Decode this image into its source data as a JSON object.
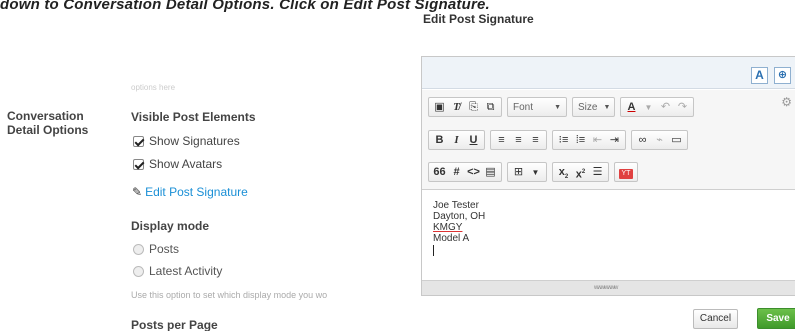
{
  "caption": "down to Conversation Detail Options. Click on Edit Post Signature.",
  "settings": {
    "hint_text": "options here",
    "section_label": "Conversation Detail Options",
    "visible_post_elements": {
      "title": "Visible Post Elements",
      "items": [
        {
          "label": "Show Signatures",
          "checked": true
        },
        {
          "label": "Show Avatars",
          "checked": true
        }
      ]
    },
    "edit_signature_link": "Edit Post Signature",
    "display_mode": {
      "title": "Display mode",
      "options": [
        {
          "label": "Posts",
          "selected": false
        },
        {
          "label": "Latest Activity",
          "selected": false
        }
      ],
      "help": "Use this option to set which display mode you wo"
    },
    "posts_per_page_title": "Posts per Page"
  },
  "dialog": {
    "title": "Edit Post Signature",
    "mode_button": "A",
    "toolbar": {
      "font_label": "Font",
      "size_label": "Size",
      "color_label": "A",
      "bold": "B",
      "italic": "I",
      "underline": "U",
      "quote": "66",
      "hash": "#",
      "code": "<>",
      "subscript": "x",
      "superscript": "x",
      "subscript_mark": "2",
      "superscript_mark": "2",
      "video": "YT"
    },
    "signature_lines": [
      "Joe Tester",
      "Dayton, OH",
      "KMGY",
      "Model A"
    ],
    "grip": "wwwwwww",
    "cancel_label": "Cancel",
    "save_label": "Save"
  }
}
